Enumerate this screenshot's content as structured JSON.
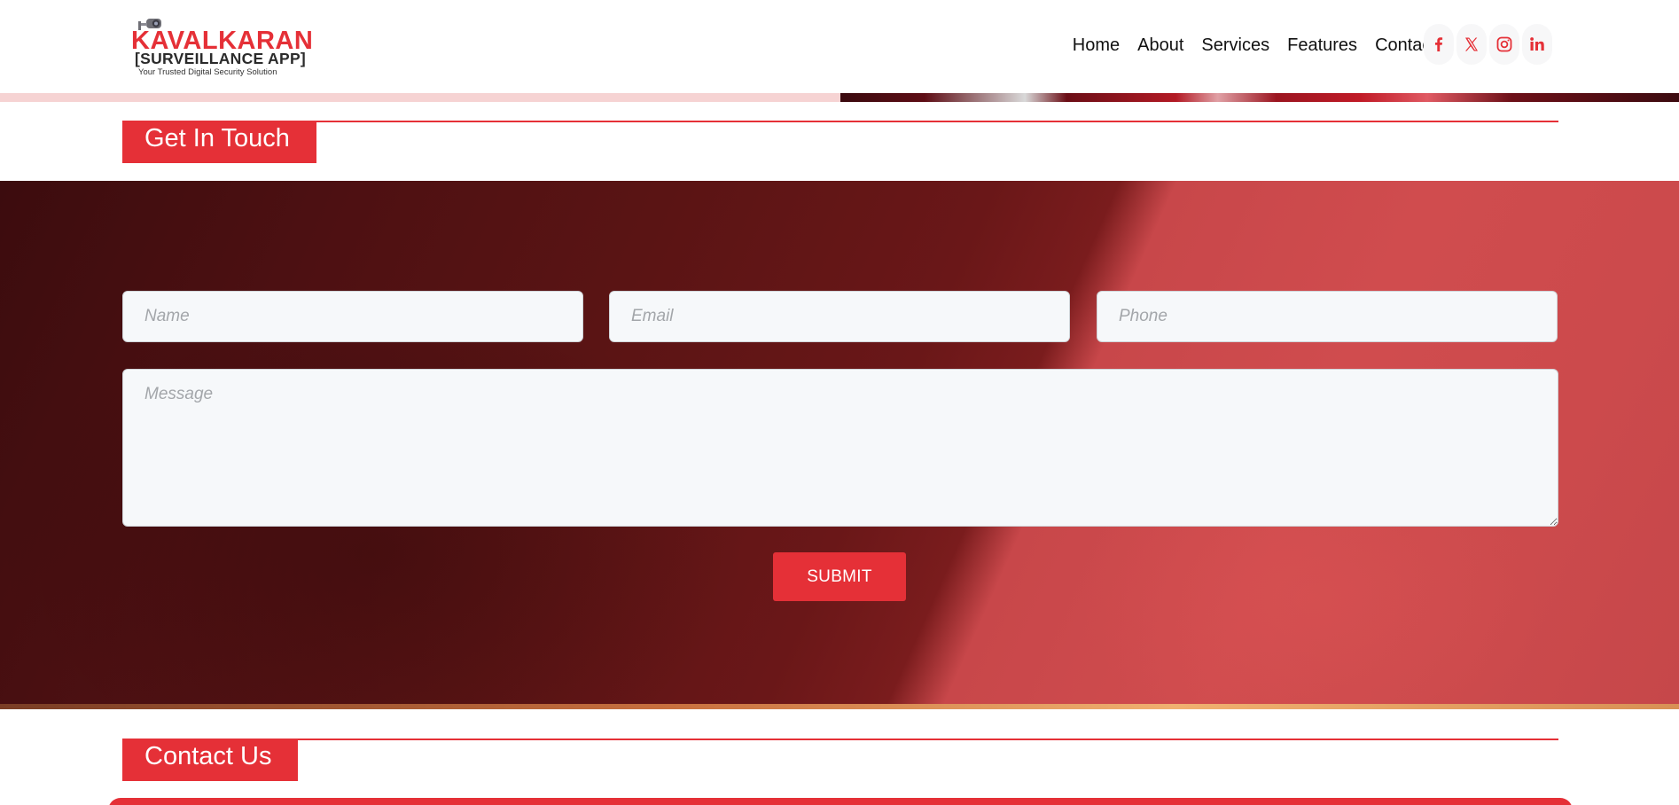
{
  "brand": {
    "title": "KAVALKARAN",
    "subtitle": "[SURVEILLANCE APP]",
    "tagline": "Your Trusted Digital Security Solution",
    "accent_color": "#e53037"
  },
  "nav": {
    "items": [
      {
        "label": "Home"
      },
      {
        "label": "About"
      },
      {
        "label": "Services"
      },
      {
        "label": "Features"
      },
      {
        "label": "Contact"
      }
    ]
  },
  "socials": [
    {
      "icon": "facebook-icon"
    },
    {
      "icon": "x-twitter-icon"
    },
    {
      "icon": "instagram-icon"
    },
    {
      "icon": "linkedin-icon"
    }
  ],
  "get_in_touch": {
    "heading": "Get In Touch",
    "form": {
      "name_placeholder": "Name",
      "email_placeholder": "Email",
      "phone_placeholder": "Phone",
      "message_placeholder": "Message",
      "submit_label": "SUBMIT"
    }
  },
  "contact_us": {
    "heading": "Contact Us"
  }
}
